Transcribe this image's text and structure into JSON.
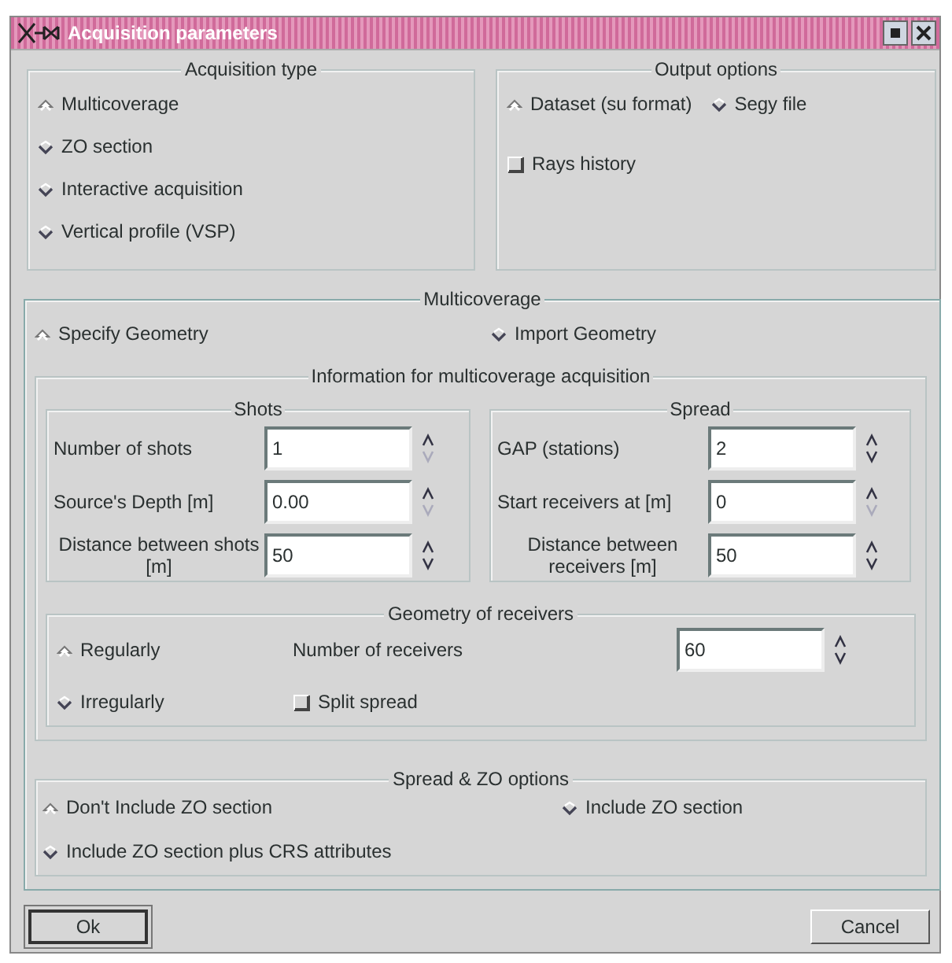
{
  "window": {
    "title": "Acquisition parameters"
  },
  "acquisition_type": {
    "title": "Acquisition type",
    "options": [
      {
        "label": "Multicoverage",
        "selected": true
      },
      {
        "label": "ZO section",
        "selected": false
      },
      {
        "label": "Interactive acquisition",
        "selected": false
      },
      {
        "label": "Vertical profile (VSP)",
        "selected": false
      }
    ]
  },
  "output_options": {
    "title": "Output options",
    "formats": [
      {
        "label": "Dataset (su format)",
        "selected": true
      },
      {
        "label": "Segy file",
        "selected": false
      }
    ],
    "rays_history": {
      "label": "Rays history",
      "checked": false
    }
  },
  "multicoverage": {
    "title": "Multicoverage",
    "geometry": [
      {
        "label": "Specify Geometry",
        "selected": true
      },
      {
        "label": "Import Geometry",
        "selected": false
      }
    ],
    "information": {
      "title": "Information for multicoverage acquisition",
      "groups": [
        {
          "title": "Shots",
          "fields": [
            {
              "label": "Number of shots",
              "value": "1",
              "down_disabled": true
            },
            {
              "label": "Source's Depth [m]",
              "value": "0.00",
              "down_disabled": true
            },
            {
              "label": "Distance between shots [m]",
              "value": "50",
              "down_disabled": false
            }
          ]
        },
        {
          "title": "Spread",
          "fields": [
            {
              "label": "GAP (stations)",
              "value": "2",
              "down_disabled": false
            },
            {
              "label": "Start receivers at [m]",
              "value": "0",
              "down_disabled": true
            },
            {
              "label": "Distance between receivers [m]",
              "value": "50",
              "down_disabled": false
            }
          ]
        }
      ],
      "geometry_of_receivers": {
        "title": "Geometry of receivers",
        "options": [
          {
            "label": "Regularly",
            "selected": true
          },
          {
            "label": "Irregularly",
            "selected": false
          }
        ],
        "number_of_receivers": {
          "label": "Number of receivers",
          "value": "60",
          "down_disabled": false
        },
        "split_spread": {
          "label": "Split spread",
          "checked": false
        }
      }
    },
    "spread_zo_options": {
      "title": "Spread & ZO options",
      "options": [
        {
          "label": "Don't Include ZO section",
          "selected": true
        },
        {
          "label": "Include ZO section",
          "selected": false
        },
        {
          "label": "Include ZO section plus CRS attributes",
          "selected": false
        }
      ]
    }
  },
  "buttons": [
    {
      "label": "Ok",
      "default": true
    },
    {
      "label": "Cancel",
      "default": false
    }
  ]
}
